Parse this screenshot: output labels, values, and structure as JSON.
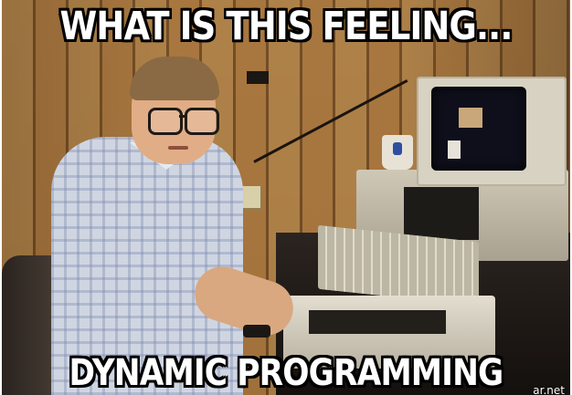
{
  "meme": {
    "top_text": "WHAT IS THIS FEELING...",
    "bottom_text": "DYNAMIC PROGRAMMING",
    "watermark": "ar.net"
  },
  "colors": {
    "caption_fill": "#ffffff",
    "caption_outline": "#000000",
    "wood_panel": "#a9773f",
    "shirt": "#cfd6e2",
    "computer_beige": "#cfc8b6"
  }
}
